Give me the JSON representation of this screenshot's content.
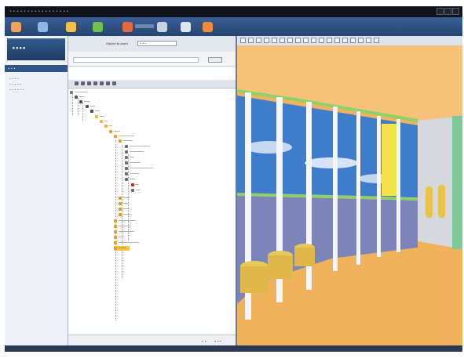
{
  "window": {
    "title": "• • • • • • • • • • • • • • • • •"
  },
  "toolbar": {
    "buttons": [
      {
        "icon": "up-arrow-icon",
        "color": "#f0a25a"
      },
      {
        "icon": "window-icon",
        "color": "#8fb6e8"
      },
      {
        "icon": "folder-icon",
        "color": "#f5c049"
      },
      {
        "icon": "refresh-icon",
        "color": "#6fc24f"
      },
      {
        "icon": "tools-icon",
        "color": "#e36b3d"
      },
      {
        "icon": "grid-icon",
        "color": "#c8d2e2"
      },
      {
        "icon": "settings-icon",
        "color": "#e0e6ef"
      },
      {
        "icon": "export-icon",
        "color": "#f08a3c"
      }
    ]
  },
  "nav": {
    "header": "• • •",
    "items": [
      "• • • •",
      "• • • • •",
      "• • • • • •"
    ]
  },
  "middle": {
    "search_label": "Object to work",
    "search_value": "• • •",
    "footer_left": "• •",
    "footer_right": "• • •"
  },
  "colors": {
    "accent": "#2f5687",
    "floor": "#f0b25a",
    "ceiling": "#f6c27a",
    "sky": "#3a78c8",
    "green_trim": "#8ed06a"
  }
}
